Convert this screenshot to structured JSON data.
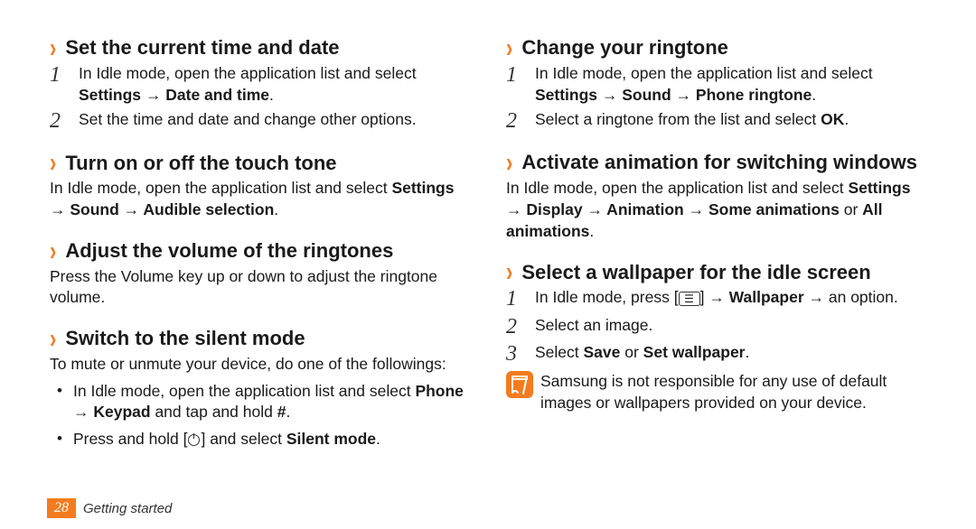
{
  "left": {
    "s1": {
      "title": "Set the current time and date",
      "step1_a": "In Idle mode, open the application list and select ",
      "step1_b_bold": "Settings → Date and time",
      "step1_c": ".",
      "step2": "Set the time and date and change other options."
    },
    "s2": {
      "title": "Turn on or off the touch tone",
      "p_a": "In Idle mode, open the application list and select ",
      "p_b_bold": "Settings → Sound → Audible selection",
      "p_c": "."
    },
    "s3": {
      "title": "Adjust the volume of the ringtones",
      "p": "Press the Volume key up or down to adjust the ringtone volume."
    },
    "s4": {
      "title": "Switch to the silent mode",
      "intro": "To mute or unmute your device, do one of the followings:",
      "b1_a": "In Idle mode, open the application list and select ",
      "b1_b_bold": "Phone → Keypad",
      "b1_c": " and tap and hold ",
      "b1_d_bold": "#",
      "b1_e": ".",
      "b2_a": "Press and hold [",
      "b2_b": "] and select ",
      "b2_c_bold": "Silent mode",
      "b2_d": "."
    }
  },
  "right": {
    "s5": {
      "title": "Change your ringtone",
      "step1_a": "In Idle mode, open the application list and select ",
      "step1_b_bold": "Settings → Sound → Phone ringtone",
      "step1_c": ".",
      "step2_a": "Select a ringtone from the list and select ",
      "step2_b_bold": "OK",
      "step2_c": "."
    },
    "s6": {
      "title": "Activate animation for switching windows",
      "p_a": "In Idle mode, open the application list and select ",
      "p_b_bold": "Settings → Display → Animation → Some animations",
      "p_c": " or ",
      "p_d_bold": "All animations",
      "p_e": "."
    },
    "s7": {
      "title": "Select a wallpaper for the idle screen",
      "step1_a": "In Idle mode, press [",
      "step1_b": "] → ",
      "step1_c_bold": "Wallpaper",
      "step1_d": " → an option.",
      "step2": "Select an image.",
      "step3_a": "Select ",
      "step3_b_bold": "Save",
      "step3_c": " or ",
      "step3_d_bold": "Set wallpaper",
      "step3_e": ".",
      "note": "Samsung is not responsible for any use of default images or wallpapers provided on your device."
    }
  },
  "footer": {
    "page": "28",
    "section": "Getting started"
  },
  "nums": {
    "n1": "1",
    "n2": "2",
    "n3": "3"
  }
}
